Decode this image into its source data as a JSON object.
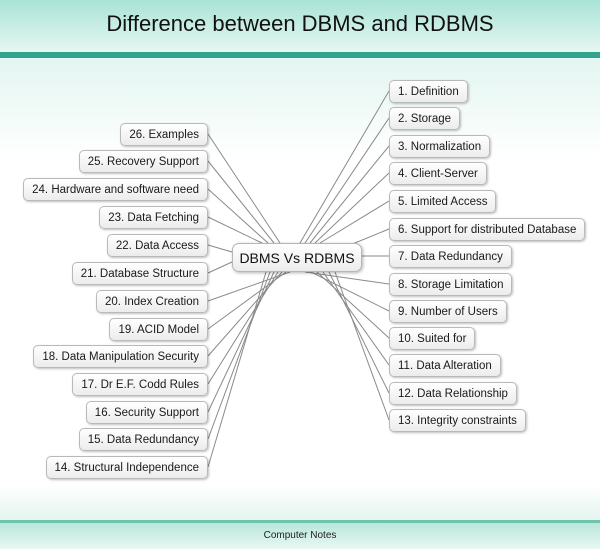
{
  "header": {
    "title": "Difference between DBMS and RDBMS"
  },
  "diagram": {
    "type": "mind-map",
    "center": "DBMS Vs RDBMS",
    "right_branches": [
      "1. Definition",
      "2. Storage",
      "3. Normalization",
      "4. Client-Server",
      "5. Limited Access",
      "6. Support for distributed Database",
      "7. Data Redundancy",
      "8. Storage Limitation",
      "9. Number of Users",
      "10.  Suited for",
      "11. Data Alteration",
      "12. Data Relationship",
      "13. Integrity constraints"
    ],
    "left_branches": [
      "26.  Examples",
      "25. Recovery Support",
      "24. Hardware and software need",
      "23. Data Fetching",
      "22. Data Access",
      "21.  Database Structure",
      "20. Index Creation",
      "19.  ACID Model",
      "18. Data Manipulation Security",
      "17. Dr E.F. Codd Rules",
      "16.  Security Support",
      "15. Data Redundancy",
      "14.  Structural Independence"
    ]
  },
  "footer": {
    "text": "Computer Notes"
  }
}
